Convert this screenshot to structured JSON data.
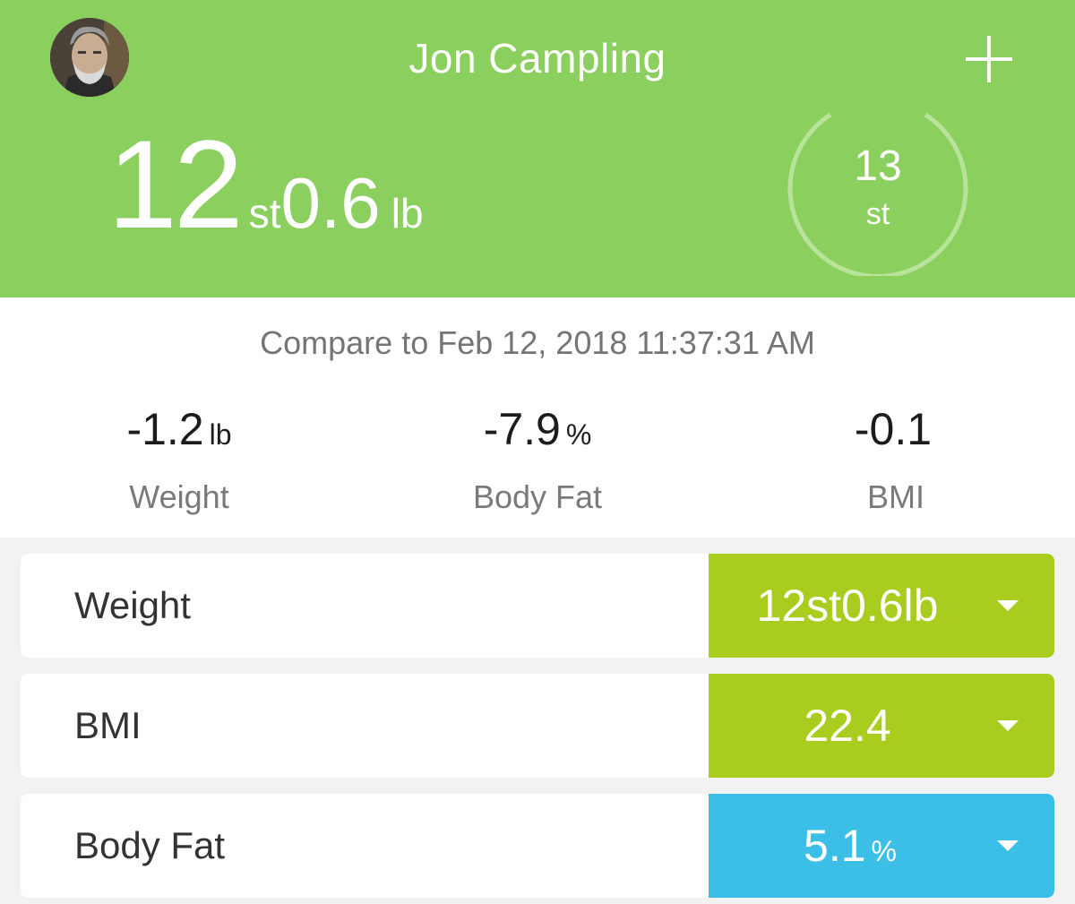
{
  "header": {
    "user_name": "Jon Campling",
    "weight_stones": "12",
    "weight_stones_unit": "st",
    "weight_pounds": "0.6",
    "weight_pounds_unit": "lb",
    "goal_value": "13",
    "goal_unit": "st",
    "add_icon": "plus-icon",
    "avatar_icon": "user-avatar",
    "background_color": "#8bcf5e"
  },
  "compare": {
    "date_text": "Compare to Feb 12, 2018 11:37:31 AM",
    "stats": [
      {
        "value": "-1.2",
        "unit": "lb",
        "label": "Weight"
      },
      {
        "value": "-7.9",
        "unit": "%",
        "label": "Body Fat"
      },
      {
        "value": "-0.1",
        "unit": "",
        "label": "BMI"
      }
    ]
  },
  "metrics": [
    {
      "name": "Weight",
      "value": "12st0.6lb",
      "unit": "",
      "color": "#a8cd1f",
      "caret_icon": "caret-down-icon"
    },
    {
      "name": "BMI",
      "value": "22.4",
      "unit": "",
      "color": "#a8cd1f",
      "caret_icon": "caret-down-icon"
    },
    {
      "name": "Body Fat",
      "value": "5.1",
      "unit": "%",
      "color": "#3bbfe6",
      "caret_icon": "caret-down-icon"
    }
  ]
}
